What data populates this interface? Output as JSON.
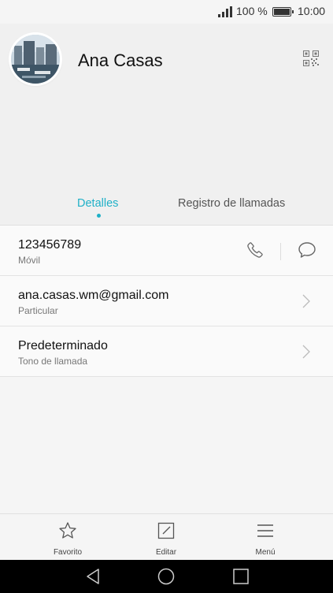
{
  "status_bar": {
    "battery_percent": "100 %",
    "time": "10:00",
    "signal_icon": "signal-icon",
    "battery_icon": "battery-icon"
  },
  "contact": {
    "name": "Ana Casas",
    "avatar_icon": "contact-photo",
    "qr_icon": "qr-code-icon"
  },
  "tabs": [
    {
      "label": "Detalles",
      "active": true
    },
    {
      "label": "Registro de llamadas",
      "active": false
    }
  ],
  "colors": {
    "accent": "#1fb0c7",
    "header_bg": "#f0f0f0",
    "list_bg": "#fafafa",
    "nav_bar": "#000000"
  },
  "details": [
    {
      "primary": "123456789",
      "secondary": "Móvil",
      "actions": [
        "phone-icon",
        "message-icon"
      ]
    },
    {
      "primary": "ana.casas.wm@gmail.com",
      "secondary": "Particular",
      "actions": [
        "chevron-right-icon"
      ]
    },
    {
      "primary": "Predeterminado",
      "secondary": "Tono de llamada",
      "actions": [
        "chevron-right-icon"
      ]
    }
  ],
  "bottom_bar": [
    {
      "label": "Favorito",
      "icon": "star-icon"
    },
    {
      "label": "Editar",
      "icon": "edit-icon"
    },
    {
      "label": "Menú",
      "icon": "menu-icon"
    }
  ],
  "nav_bar": {
    "icons": [
      "back-icon",
      "home-icon",
      "recents-icon"
    ]
  }
}
